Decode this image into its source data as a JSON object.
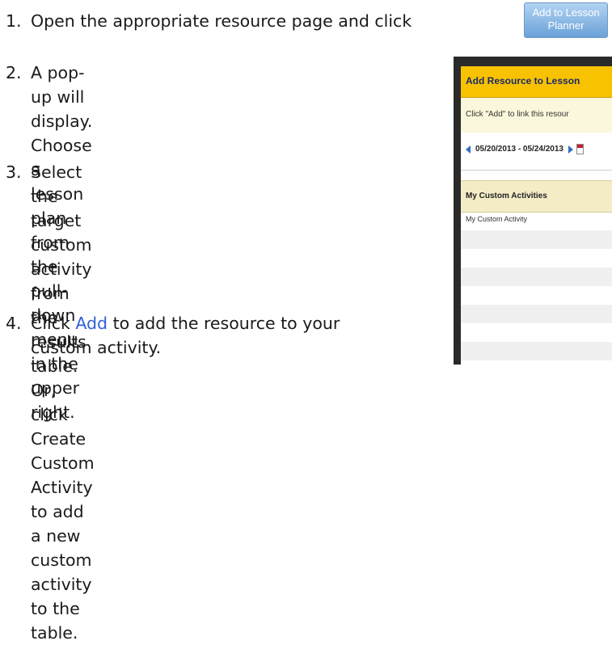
{
  "steps": [
    {
      "number": "1.",
      "text": "Open the appropriate resource page and click"
    },
    {
      "number": "2.",
      "lines": [
        "A pop-up will display. Choose a lesson",
        "plan from the pull-down menu in the",
        "upper right."
      ]
    },
    {
      "number": "3.",
      "lines": [
        "Select the target custom activity from",
        "the results table. Or, click Create",
        "Custom Activity to add a new custom",
        "activity to the table."
      ]
    },
    {
      "number": "4.",
      "prefix": "Click ",
      "link": "Add",
      "rest": " to add the resource to your",
      "line2": "custom activity."
    }
  ],
  "inline_button": {
    "line1": "Add to Lesson",
    "line2": "Planner"
  },
  "popup": {
    "title": "Add Resource to Lesson",
    "notice": "Click \"Add\" to link this resour",
    "date_range": "05/20/2013 - 05/24/2013",
    "table_header": "My Custom Activities",
    "rows": [
      "My Custom Activity"
    ]
  },
  "colors": {
    "popup_titlebar": "#f8c200",
    "link": "#2f5fd8",
    "button_gradient": "#6aa1d8"
  }
}
